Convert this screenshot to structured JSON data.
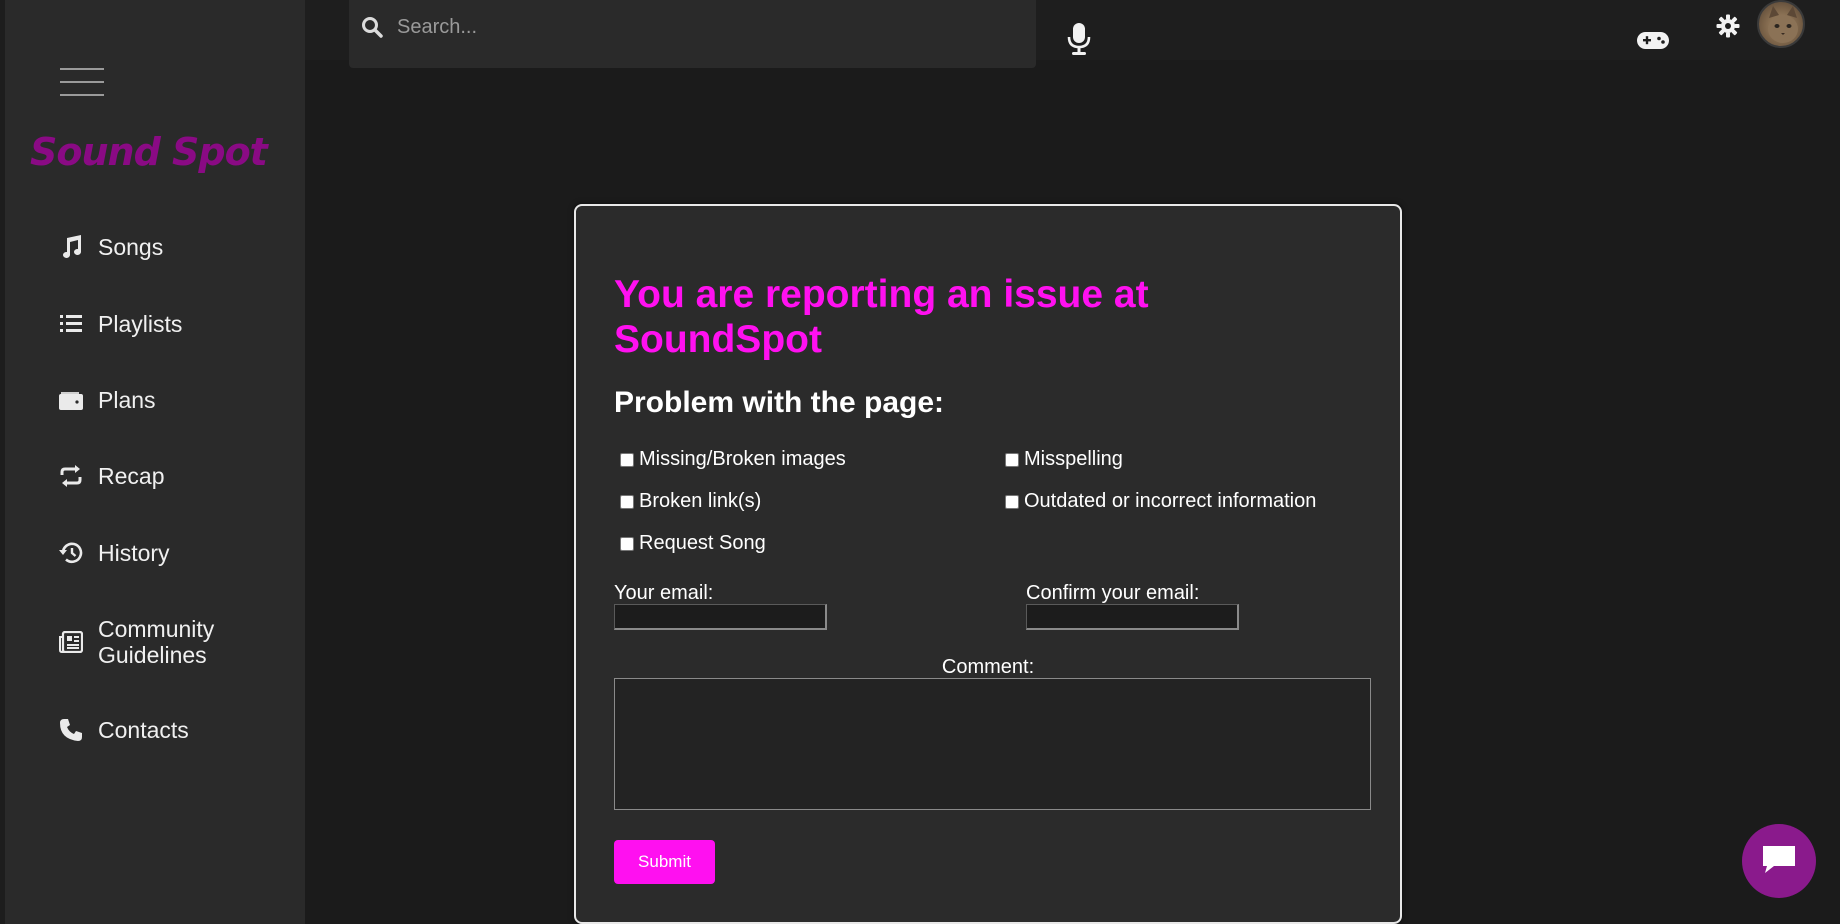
{
  "sidebar": {
    "logo": "Sound Spot",
    "items": [
      {
        "label": "Songs",
        "icon": "music-note-icon"
      },
      {
        "label": "Playlists",
        "icon": "list-icon"
      },
      {
        "label": "Plans",
        "icon": "wallet-icon"
      },
      {
        "label": "Recap",
        "icon": "repeat-icon"
      },
      {
        "label": "History",
        "icon": "history-icon"
      },
      {
        "label": "Community Guidelines",
        "icon": "newspaper-icon"
      },
      {
        "label": "Contacts",
        "icon": "phone-icon"
      }
    ]
  },
  "header": {
    "search_placeholder": "Search...",
    "icons": [
      "search-icon",
      "microphone-icon",
      "gamepad-icon",
      "gear-icon",
      "avatar"
    ]
  },
  "form": {
    "title": "You are reporting an issue at SoundSpot",
    "subtitle": "Problem with the page:",
    "checkboxes": [
      {
        "label": "Missing/Broken images",
        "checked": false
      },
      {
        "label": "Misspelling",
        "checked": false
      },
      {
        "label": "Broken link(s)",
        "checked": false
      },
      {
        "label": "Outdated or incorrect information",
        "checked": false
      },
      {
        "label": "Request Song",
        "checked": false
      }
    ],
    "email_label": "Your email:",
    "confirm_email_label": "Confirm your email:",
    "comment_label": "Comment:",
    "submit_label": "Submit"
  },
  "colors": {
    "accent": "#ff10f0",
    "logo": "#8a0a84",
    "chat_button": "#8a1a8c",
    "sidebar_bg": "#2a2a2a",
    "page_bg": "#1b1b1b",
    "card_bg": "#2b2b2b"
  }
}
